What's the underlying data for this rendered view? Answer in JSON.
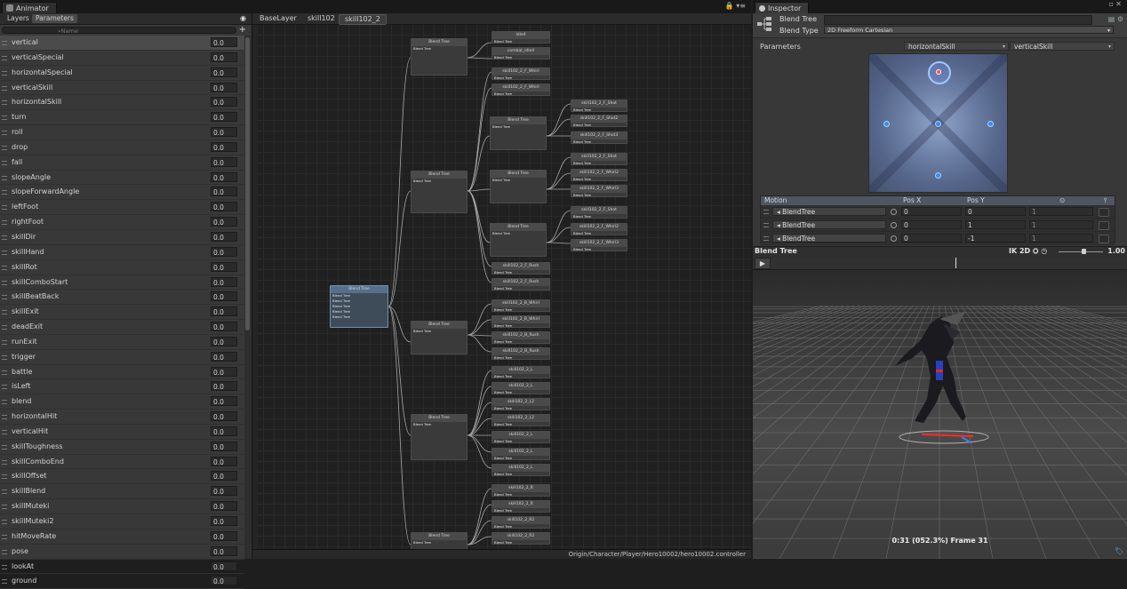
{
  "animator": {
    "window_title": "Animator",
    "tabs": [
      "Layers",
      "Parameters"
    ],
    "active_tab": "Parameters",
    "search_placeholder": "Name",
    "add_label": "+",
    "parameters": [
      {
        "name": "vertical",
        "value": "0.0"
      },
      {
        "name": "verticalSpecial",
        "value": "0.0"
      },
      {
        "name": "horizontalSpecial",
        "value": "0.0"
      },
      {
        "name": "verticalSkill",
        "value": "0.0"
      },
      {
        "name": "horizontalSkill",
        "value": "0.0"
      },
      {
        "name": "turn",
        "value": "0.0"
      },
      {
        "name": "roll",
        "value": "0.0"
      },
      {
        "name": "drop",
        "value": "0.0"
      },
      {
        "name": "fall",
        "value": "0.0"
      },
      {
        "name": "slopeAngle",
        "value": "0.0"
      },
      {
        "name": "slopeForwardAngle",
        "value": "0.0"
      },
      {
        "name": "leftFoot",
        "value": "0.0"
      },
      {
        "name": "rightFoot",
        "value": "0.0"
      },
      {
        "name": "skillDir",
        "value": "0.0"
      },
      {
        "name": "skillHand",
        "value": "0.0"
      },
      {
        "name": "skillRot",
        "value": "0.0"
      },
      {
        "name": "skillComboStart",
        "value": "0.0"
      },
      {
        "name": "skillBeatBack",
        "value": "0.0"
      },
      {
        "name": "skillExit",
        "value": "0.0"
      },
      {
        "name": "deadExit",
        "value": "0.0"
      },
      {
        "name": "runExit",
        "value": "0.0"
      },
      {
        "name": "trigger",
        "value": "0.0"
      },
      {
        "name": "battle",
        "value": "0.0"
      },
      {
        "name": "isLeft",
        "value": "0.0"
      },
      {
        "name": "blend",
        "value": "0.0"
      },
      {
        "name": "horizontalHit",
        "value": "0.0"
      },
      {
        "name": "verticalHit",
        "value": "0.0"
      },
      {
        "name": "skillToughness",
        "value": "0.0"
      },
      {
        "name": "skillComboEnd",
        "value": "0.0"
      },
      {
        "name": "skillOffset",
        "value": "0.0"
      },
      {
        "name": "skillBlend",
        "value": "0.0"
      },
      {
        "name": "skillMuteki",
        "value": "0.0"
      },
      {
        "name": "skillMuteki2",
        "value": "0.0"
      },
      {
        "name": "hitMoveRate",
        "value": "0.0"
      },
      {
        "name": "pose",
        "value": "0.0"
      },
      {
        "name": "lookAt",
        "value": "0.0"
      },
      {
        "name": "ground",
        "value": "0.0"
      }
    ],
    "breadcrumbs": [
      "BaseLayer",
      "skill102",
      "skill102_2"
    ],
    "status_path": "Origin/Character/Player/Hero10002/hero10002.controller",
    "graph": {
      "root": {
        "title": "Blend Tree",
        "sub": [
          "Blend Tree",
          "Blend Tree",
          "Blend Tree",
          "Blend Tree",
          "Blend Tree"
        ]
      },
      "mid_nodes": [
        {
          "title": "Blend Tree",
          "sub": "Blend Tree"
        },
        {
          "title": "Blend Tree",
          "sub": "Blend Tree"
        },
        {
          "title": "Blend Tree",
          "sub": "Blend Tree"
        },
        {
          "title": "Blend Tree",
          "sub": "Blend Tree"
        },
        {
          "title": "Blend Tree",
          "sub": "Blend Tree"
        },
        {
          "title": "Blend Tree",
          "sub": "Blend Tree"
        },
        {
          "title": "Blend Tree",
          "sub": "Blend Tree"
        }
      ],
      "leaves_a": [
        {
          "title": "Idle4",
          "sub": "Blend Tree"
        },
        {
          "title": "combat_idle4",
          "sub": "Blend Tree"
        },
        {
          "title": "skill102_2_F_Whirl",
          "sub": "Blend Tree"
        },
        {
          "title": "skill102_2_F_Whirl",
          "sub": "Blend Tree"
        },
        {
          "title": "skill102_2_F_Rush",
          "sub": "Blend Tree"
        },
        {
          "title": "skill102_2_F_Rush",
          "sub": "Blend Tree"
        },
        {
          "title": "skill102_2_B_Whirl",
          "sub": "Blend Tree"
        },
        {
          "title": "skill102_2_B_Whirl",
          "sub": "Blend Tree"
        },
        {
          "title": "skill102_2_B_Rush",
          "sub": "Blend Tree"
        },
        {
          "title": "skill102_2_B_Rush",
          "sub": "Blend Tree"
        },
        {
          "title": "skill102_2_L",
          "sub": "Blend Tree"
        },
        {
          "title": "skill102_2_L",
          "sub": "Blend Tree"
        },
        {
          "title": "skill102_2_L2",
          "sub": "Blend Tree"
        },
        {
          "title": "skill102_2_L2",
          "sub": "Blend Tree"
        },
        {
          "title": "skill102_2_L",
          "sub": "Blend Tree"
        },
        {
          "title": "skill102_2_L",
          "sub": "Blend Tree"
        },
        {
          "title": "skill102_2_L",
          "sub": "Blend Tree"
        },
        {
          "title": "skill102_2_R",
          "sub": "Blend Tree"
        },
        {
          "title": "skill102_2_R",
          "sub": "Blend Tree"
        },
        {
          "title": "skill102_2_R2",
          "sub": "Blend Tree"
        },
        {
          "title": "skill102_2_R2",
          "sub": "Blend Tree"
        }
      ],
      "leaves_b": [
        {
          "title": "skill102_2_F_Shot",
          "sub": "Blend Tree"
        },
        {
          "title": "skill102_2_F_Shot2",
          "sub": "Blend Tree"
        },
        {
          "title": "skill102_2_F_Shot3",
          "sub": "Blend Tree"
        },
        {
          "title": "skill102_2_F_Shot",
          "sub": "Blend Tree"
        },
        {
          "title": "skill102_2_F_Whirl2",
          "sub": "Blend Tree"
        },
        {
          "title": "skill102_2_F_Whirl3",
          "sub": "Blend Tree"
        },
        {
          "title": "skill102_2_F_Shot",
          "sub": "Blend Tree"
        },
        {
          "title": "skill102_2_F_Whirl2",
          "sub": "Blend Tree"
        },
        {
          "title": "skill102_2_F_Whirl3",
          "sub": "Blend Tree"
        }
      ]
    }
  },
  "inspector": {
    "tab_title": "Inspector",
    "name_label": "Blend Tree",
    "blend_type_label": "Blend Type",
    "blend_type_value": "2D Freeform Cartesian",
    "parameters_label": "Parameters",
    "param_x": "horizontalSkill",
    "param_y": "verticalSkill",
    "motion_header": {
      "motion": "Motion",
      "posx": "Pos X",
      "posy": "Pos Y"
    },
    "motions": [
      {
        "name": "BlendTree",
        "x": "0",
        "y": "0",
        "speed": "1"
      },
      {
        "name": "BlendTree",
        "x": "0",
        "y": "1",
        "speed": "1"
      },
      {
        "name": "BlendTree",
        "x": "0",
        "y": "-1",
        "speed": "1"
      }
    ],
    "preview_title": "Blend Tree",
    "preview_ik": "IK",
    "preview_2d": "2D",
    "preview_speed": "1.00",
    "frame_label": "0:31 (052.3%) Frame 31",
    "play_icon": "play-icon"
  }
}
